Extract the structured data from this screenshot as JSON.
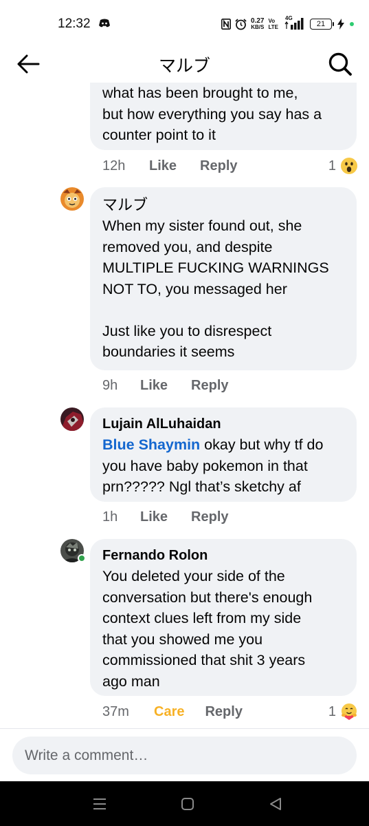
{
  "status_bar": {
    "time": "12:32",
    "net_speed_value": "0.27",
    "net_speed_unit": "KB/S",
    "volte_top": "Vo",
    "volte_bottom": "LTE",
    "network": "4G",
    "battery": "21"
  },
  "header": {
    "title": "マルブ"
  },
  "comments": [
    {
      "text": "what has been brought to me,\nbut how everything you say has a\ncounter point to it",
      "time": "12h",
      "like_label": "Like",
      "reply_label": "Reply",
      "reaction_count": "1",
      "reaction_icon": "wow-emoji-icon"
    },
    {
      "author": "マルブ",
      "text": "When my sister found out, she\nremoved you, and despite\nMULTIPLE FUCKING WARNINGS\nNOT TO, you messaged her\n\nJust like you to disrespect\nboundaries it seems",
      "time": "9h",
      "like_label": "Like",
      "reply_label": "Reply"
    },
    {
      "author": "Lujain AlLuhaidan",
      "mention": "Blue Shaymin",
      "text": " okay but why tf do\nyou have baby pokemon in that\nprn????? Ngl that’s sketchy af",
      "time": "1h",
      "like_label": "Like",
      "reply_label": "Reply"
    },
    {
      "author": "Fernando Rolon",
      "text": "You deleted your side of the\nconversation but there's enough\ncontext clues left from my side\nthat you showed me you\ncommissioned that shit 3 years\nago man",
      "time": "37m",
      "like_label": "Care",
      "reply_label": "Reply",
      "reaction_count": "1",
      "reaction_icon": "care-emoji-icon"
    }
  ],
  "composer": {
    "placeholder": "Write a comment…"
  },
  "colors": {
    "bubble": "#f0f2f5",
    "mention": "#1467cf",
    "care": "#f7b125",
    "secondary_text": "#65676b",
    "online": "#31a24c"
  }
}
